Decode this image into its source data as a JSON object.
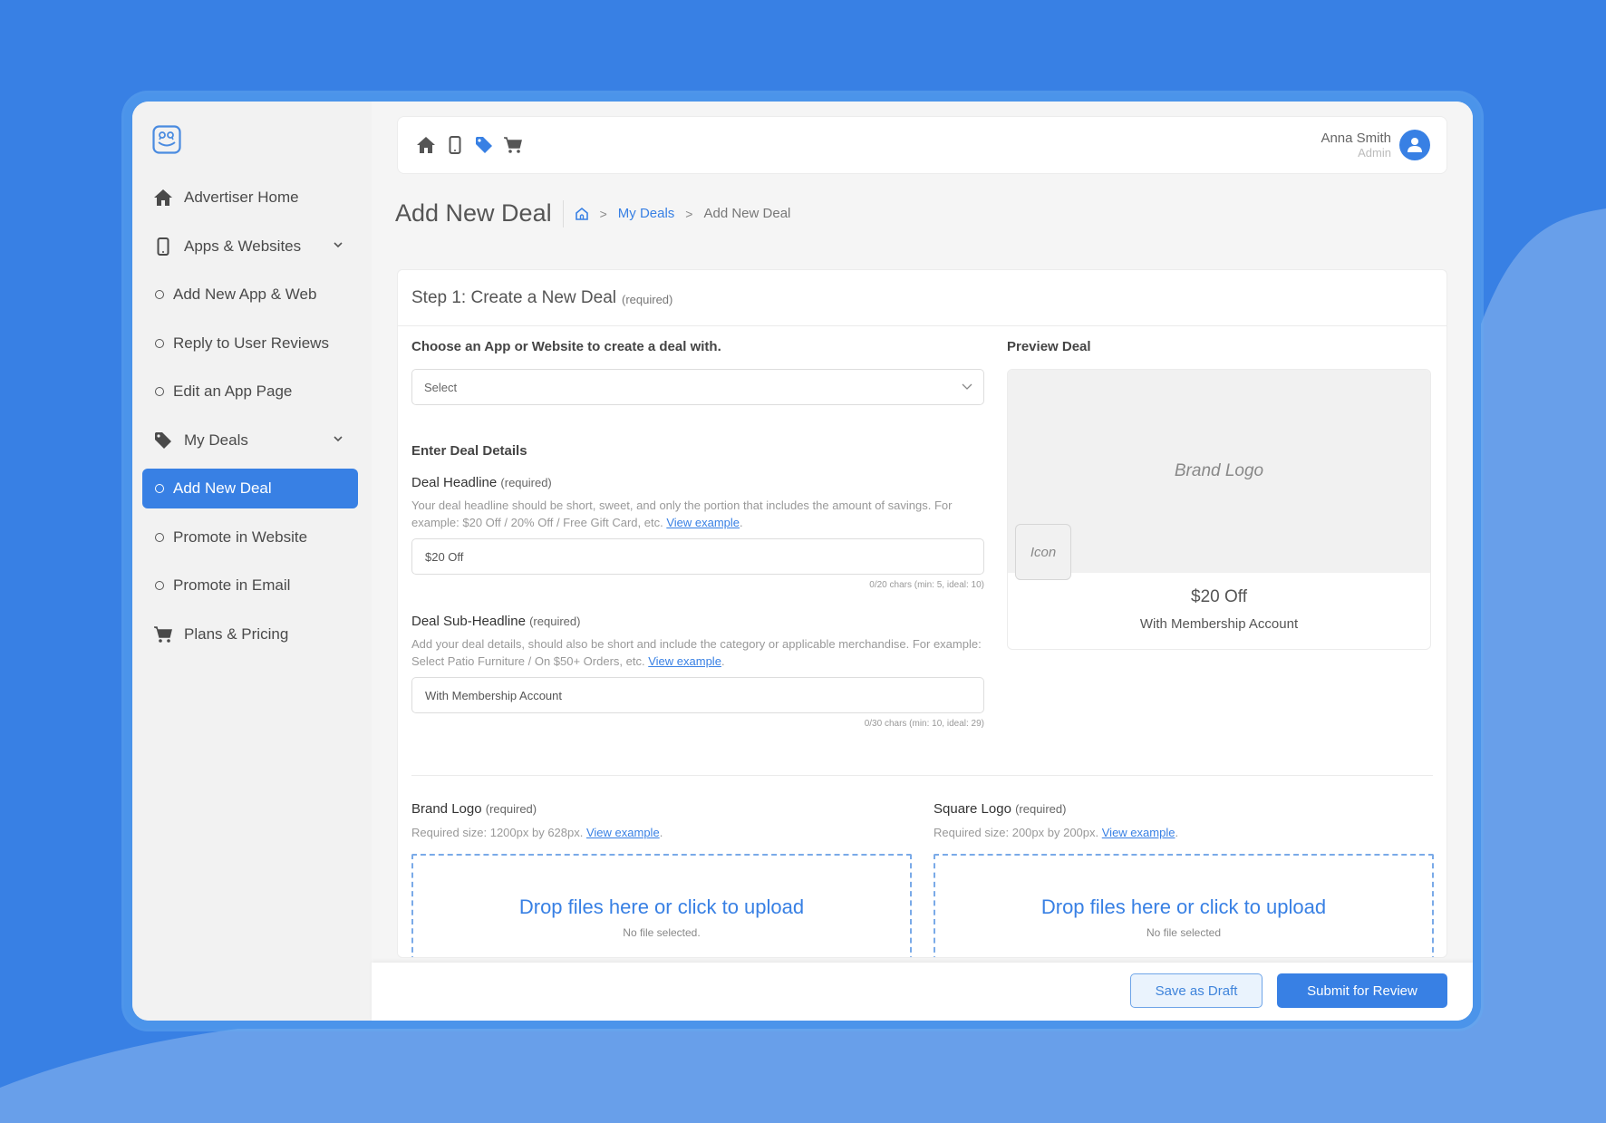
{
  "colors": {
    "accent": "#3880E4",
    "background": "#3880E4",
    "background_light": "#689FEA",
    "sidebar_bg": "#F2F2F2"
  },
  "sidebar": {
    "logo_icon": "smiley-face-logo",
    "items": [
      {
        "label": "Advertiser Home",
        "icon": "home-icon",
        "type": "section"
      },
      {
        "label": "Apps & Websites",
        "icon": "mobile-icon",
        "type": "section",
        "expandable": true
      },
      {
        "label": "Add New App & Web",
        "icon": "circle-icon",
        "type": "sub"
      },
      {
        "label": "Reply to User Reviews",
        "icon": "circle-icon",
        "type": "sub"
      },
      {
        "label": "Edit an App Page",
        "icon": "circle-icon",
        "type": "sub"
      },
      {
        "label": "My Deals",
        "icon": "tag-icon",
        "type": "section",
        "expandable": true
      },
      {
        "label": "Add New Deal",
        "icon": "circle-icon",
        "type": "sub",
        "active": true
      },
      {
        "label": "Promote in Website",
        "icon": "circle-icon",
        "type": "sub"
      },
      {
        "label": "Promote in Email",
        "icon": "circle-icon",
        "type": "sub"
      },
      {
        "label": "Plans & Pricing",
        "icon": "cart-icon",
        "type": "section"
      }
    ]
  },
  "topbar": {
    "icons": [
      "home-icon",
      "mobile-icon",
      "tag-icon",
      "cart-icon"
    ],
    "active_icon": "tag-icon",
    "user": {
      "name": "Anna Smith",
      "role": "Admin"
    }
  },
  "page": {
    "title": "Add New Deal",
    "breadcrumb": [
      "My Deals",
      "Add New Deal"
    ]
  },
  "form": {
    "step_title": "Step 1: Create a New Deal",
    "step_required": "(required)",
    "choose_label": "Choose an App or Website to create a deal with.",
    "select_value": "Select",
    "details_heading": "Enter Deal Details",
    "headline": {
      "label": "Deal Headline",
      "required": "(required)",
      "help": "Your deal headline should be short, sweet, and only the portion that includes the amount of savings. For example: $20 Off / 20% Off / Free Gift Card, etc.",
      "link": "View example",
      "value": "$20 Off",
      "counter": "0/20 chars (min: 5, ideal: 10)"
    },
    "subheadline": {
      "label": "Deal Sub-Headline",
      "required": "(required)",
      "help": "Add your deal details, should also be short and include the category or applicable merchandise. For example: Select Patio Furniture / On $50+ Orders, etc.",
      "link": "View example",
      "value": "With Membership Account",
      "counter": "0/30 chars (min: 10, ideal: 29)"
    },
    "brand_logo": {
      "label": "Brand Logo",
      "required": "(required)",
      "help": "Required size: 1200px by 628px.",
      "link": "View example",
      "drop_text": "Drop files here or click to upload",
      "status": "No file selected."
    },
    "square_logo": {
      "label": "Square Logo",
      "required": "(required)",
      "help": "Required size: 200px by 200px.",
      "link": "View example",
      "drop_text": "Drop files here or click to upload",
      "status": "No file selected"
    }
  },
  "preview": {
    "label": "Preview Deal",
    "brand_placeholder": "Brand Logo",
    "icon_placeholder": "Icon",
    "headline": "$20 Off",
    "subheadline": "With Membership Account"
  },
  "footer": {
    "draft_label": "Save as Draft",
    "submit_label": "Submit for Review"
  }
}
